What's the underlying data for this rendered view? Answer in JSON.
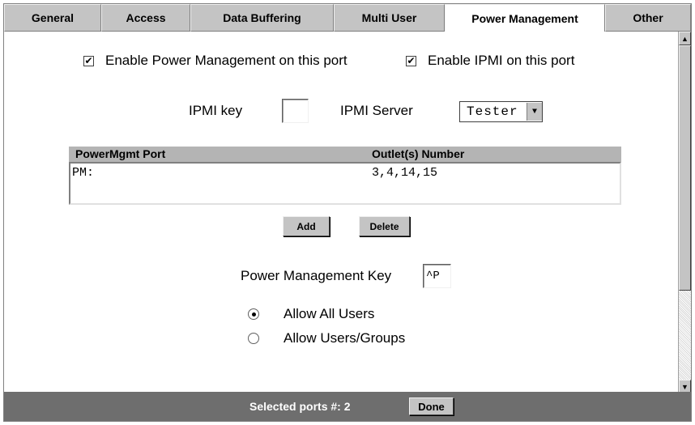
{
  "tabs": [
    {
      "label": "General"
    },
    {
      "label": "Access"
    },
    {
      "label": "Data Buffering"
    },
    {
      "label": "Multi User"
    },
    {
      "label": "Power Management"
    },
    {
      "label": "Other"
    }
  ],
  "active_tab": "Power Management",
  "options": {
    "enable_pm_label": "Enable Power Management on this port",
    "enable_pm_checked": true,
    "enable_ipmi_label": "Enable IPMI on this port",
    "enable_ipmi_checked": true
  },
  "ipmi": {
    "key_label": "IPMI key",
    "key_value": "",
    "server_label": "IPMI Server",
    "server_value": "Tester"
  },
  "table": {
    "headers": [
      "PowerMgmt Port",
      "Outlet(s) Number"
    ],
    "rows": [
      {
        "port": "PM:",
        "outlets": "3,4,14,15"
      }
    ]
  },
  "buttons": {
    "add": "Add",
    "delete": "Delete",
    "done": "Done"
  },
  "pm_key": {
    "label": "Power Management Key",
    "value": "^P"
  },
  "users": {
    "allow_all": "Allow All Users",
    "allow_groups": "Allow Users/Groups",
    "selected": "allow_all"
  },
  "footer": {
    "selected_ports": "Selected ports #: 2"
  }
}
